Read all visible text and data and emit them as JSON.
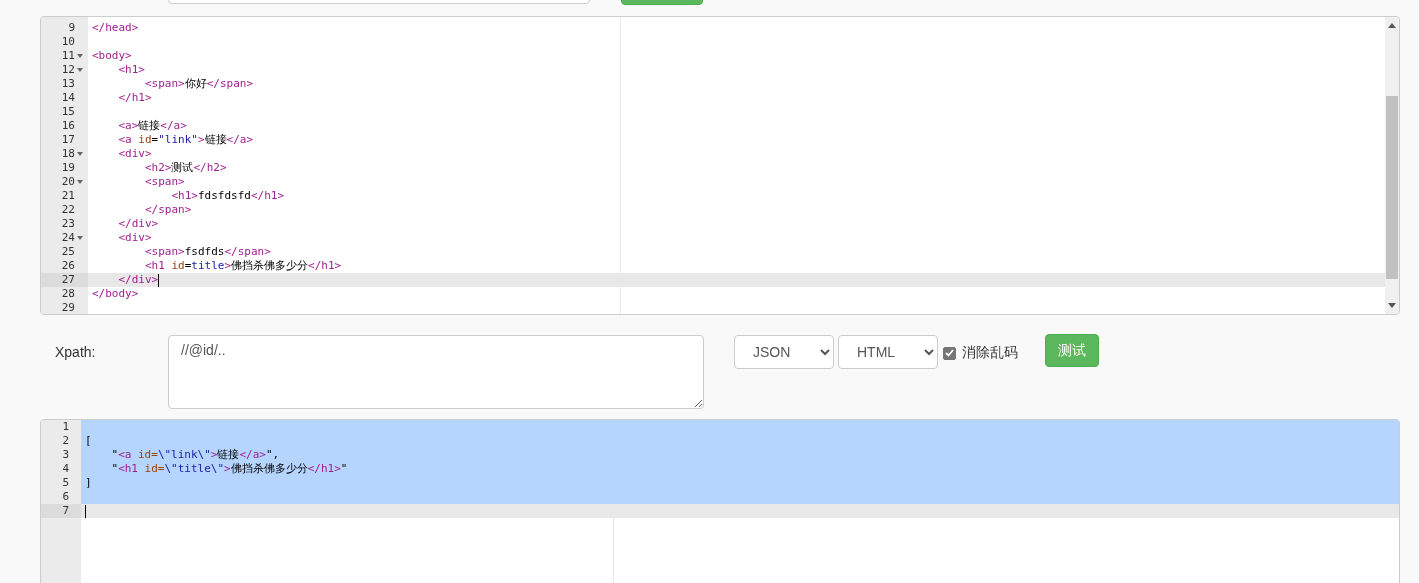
{
  "source_editor": {
    "lines": [
      {
        "num": "9",
        "fold": false,
        "active": false,
        "tokens": [
          {
            "kind": "tag",
            "text": "</head>"
          }
        ]
      },
      {
        "num": "10",
        "fold": false,
        "active": false
      },
      {
        "num": "11",
        "fold": true,
        "active": false,
        "tokens": [
          {
            "kind": "tag",
            "text": "<body>"
          }
        ]
      },
      {
        "num": "12",
        "fold": true,
        "active": false,
        "tokens": [
          {
            "kind": "tag",
            "text": "    <h1>"
          }
        ]
      },
      {
        "num": "13",
        "fold": false,
        "active": false,
        "tokens": [
          {
            "kind": "tag",
            "text": "        <span>"
          },
          {
            "kind": "text",
            "text": "你好"
          },
          {
            "kind": "tag",
            "text": "</span>"
          }
        ]
      },
      {
        "num": "14",
        "fold": false,
        "active": false,
        "tokens": [
          {
            "kind": "tag",
            "text": "    </h1>"
          }
        ]
      },
      {
        "num": "15",
        "fold": false,
        "active": false
      },
      {
        "num": "16",
        "fold": false,
        "active": false,
        "tokens": [
          {
            "kind": "tag",
            "text": "    <a>"
          },
          {
            "kind": "text",
            "text": "链接"
          },
          {
            "kind": "tag",
            "text": "</a>"
          }
        ]
      },
      {
        "num": "17",
        "fold": false,
        "active": false,
        "tokens": [
          {
            "kind": "tag",
            "text": "    <a "
          },
          {
            "kind": "attr",
            "text": "id"
          },
          {
            "kind": "text",
            "text": "="
          },
          {
            "kind": "value",
            "text": "\"link\""
          },
          {
            "kind": "tag",
            "text": ">"
          },
          {
            "kind": "text",
            "text": "链接"
          },
          {
            "kind": "tag",
            "text": "</a>"
          }
        ]
      },
      {
        "num": "18",
        "fold": true,
        "active": false,
        "tokens": [
          {
            "kind": "tag",
            "text": "    <div>"
          }
        ]
      },
      {
        "num": "19",
        "fold": false,
        "active": false,
        "tokens": [
          {
            "kind": "tag",
            "text": "        <h2>"
          },
          {
            "kind": "text",
            "text": "测试"
          },
          {
            "kind": "tag",
            "text": "</h2>"
          }
        ]
      },
      {
        "num": "20",
        "fold": true,
        "active": false,
        "tokens": [
          {
            "kind": "tag",
            "text": "        <span>"
          }
        ]
      },
      {
        "num": "21",
        "fold": false,
        "active": false,
        "tokens": [
          {
            "kind": "tag",
            "text": "            <h1>"
          },
          {
            "kind": "text",
            "text": "fdsfdsfd"
          },
          {
            "kind": "tag",
            "text": "</h1>"
          }
        ]
      },
      {
        "num": "22",
        "fold": false,
        "active": false,
        "tokens": [
          {
            "kind": "tag",
            "text": "        </span>"
          }
        ]
      },
      {
        "num": "23",
        "fold": false,
        "active": false,
        "tokens": [
          {
            "kind": "tag",
            "text": "    </div>"
          }
        ]
      },
      {
        "num": "24",
        "fold": true,
        "active": false,
        "tokens": [
          {
            "kind": "tag",
            "text": "    <div>"
          }
        ]
      },
      {
        "num": "25",
        "fold": false,
        "active": false,
        "tokens": [
          {
            "kind": "tag",
            "text": "        <span>"
          },
          {
            "kind": "text",
            "text": "fsdfds"
          },
          {
            "kind": "tag",
            "text": "</span>"
          }
        ]
      },
      {
        "num": "26",
        "fold": false,
        "active": false,
        "tokens": [
          {
            "kind": "tag",
            "text": "        <h1 "
          },
          {
            "kind": "attr",
            "text": "id"
          },
          {
            "kind": "text",
            "text": "="
          },
          {
            "kind": "value",
            "text": "title"
          },
          {
            "kind": "tag",
            "text": ">"
          },
          {
            "kind": "text",
            "text": "佛挡杀佛多少分"
          },
          {
            "kind": "tag",
            "text": "</h1>"
          }
        ]
      },
      {
        "num": "27",
        "fold": false,
        "active": true,
        "tokens": [
          {
            "kind": "tag",
            "text": "    </div>"
          }
        ]
      },
      {
        "num": "28",
        "fold": false,
        "active": false,
        "tokens": [
          {
            "kind": "tag",
            "text": "</body>"
          }
        ]
      },
      {
        "num": "29",
        "fold": false,
        "active": false
      }
    ]
  },
  "xpath": {
    "label": "Xpath:",
    "value": "//@id/.."
  },
  "output_format": {
    "value": "JSON"
  },
  "input_format": {
    "value": "HTML"
  },
  "fix_garbled": {
    "label": "消除乱码",
    "checked": true
  },
  "test_button": {
    "label": "测试"
  },
  "result_editor": {
    "lines": [
      {
        "num": "1",
        "selected": true,
        "active": false
      },
      {
        "num": "2",
        "selected": true,
        "active": false,
        "tokens": [
          {
            "kind": "text",
            "text": "["
          }
        ]
      },
      {
        "num": "3",
        "selected": true,
        "active": false,
        "tokens": [
          {
            "kind": "text",
            "text": "    \""
          },
          {
            "kind": "tag",
            "text": "<a"
          },
          {
            "kind": "attr",
            "text": " id="
          },
          {
            "kind": "value",
            "text": "\\\"link\\\""
          },
          {
            "kind": "tag",
            "text": ">"
          },
          {
            "kind": "text",
            "text": "链接"
          },
          {
            "kind": "tag",
            "text": "</a>"
          },
          {
            "kind": "text",
            "text": "\","
          }
        ]
      },
      {
        "num": "4",
        "selected": true,
        "active": false,
        "tokens": [
          {
            "kind": "text",
            "text": "    \""
          },
          {
            "kind": "tag",
            "text": "<h1"
          },
          {
            "kind": "attr",
            "text": " id="
          },
          {
            "kind": "value",
            "text": "\\\"title\\\""
          },
          {
            "kind": "tag",
            "text": ">"
          },
          {
            "kind": "text",
            "text": "佛挡杀佛多少分"
          },
          {
            "kind": "tag",
            "text": "</h1>"
          },
          {
            "kind": "text",
            "text": "\""
          }
        ]
      },
      {
        "num": "5",
        "selected": true,
        "active": false,
        "tokens": [
          {
            "kind": "text",
            "text": "]"
          }
        ]
      },
      {
        "num": "6",
        "selected": true,
        "active": false
      },
      {
        "num": "7",
        "selected": false,
        "active": true
      }
    ]
  }
}
